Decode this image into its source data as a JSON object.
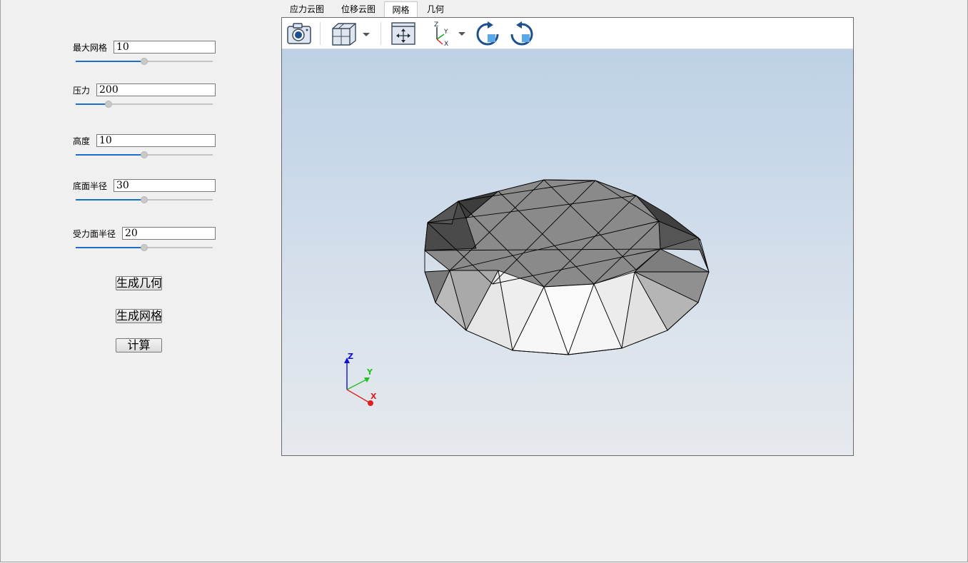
{
  "tabs": [
    {
      "label": "应力云图"
    },
    {
      "label": "位移云图"
    },
    {
      "label": "网格",
      "active": true
    },
    {
      "label": "几何"
    }
  ],
  "params": {
    "max_mesh": {
      "label": "最大网格",
      "value": "10",
      "slider": 0.5
    },
    "pressure": {
      "label": "压力",
      "value": "200",
      "slider": 0.24
    },
    "height": {
      "label": "高度",
      "value": "10",
      "slider": 0.5
    },
    "base_radius": {
      "label": "底面半径",
      "value": "30",
      "slider": 0.5
    },
    "load_radius": {
      "label": "受力面半径",
      "value": "20",
      "slider": 0.5
    }
  },
  "buttons": {
    "gen_geometry": "生成几何",
    "gen_mesh": "生成网格",
    "compute": "计算"
  },
  "toolbar": {
    "icons": [
      "camera-icon",
      "view-cube-icon",
      "fit-view-icon",
      "axis-orientation-icon",
      "rotate-clockwise-icon",
      "rotate-counterclockwise-icon"
    ],
    "axis_labels": {
      "z": "Z",
      "y": "Y",
      "x": "X"
    }
  },
  "triad": {
    "z": "Z",
    "y": "Y",
    "x": "X"
  },
  "colors": {
    "accent": "#1a6fc8",
    "scene_top": "#bdd1e6",
    "scene_bottom": "#e6e9ed",
    "axis_x": "#e02020",
    "axis_y": "#20c020",
    "axis_z": "#1010d0"
  }
}
